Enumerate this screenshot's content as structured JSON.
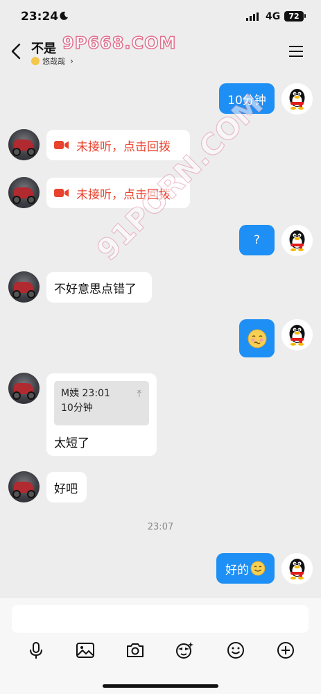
{
  "status_bar": {
    "time": "23:24",
    "network": "4G",
    "battery": "72"
  },
  "header": {
    "title": "不是",
    "status": "悠哉哉",
    "watermark_top": "9P668.COM"
  },
  "watermark_diagonal": "91PORN.COM",
  "messages": [
    {
      "side": "out",
      "text": "10分钟"
    },
    {
      "side": "in",
      "type": "missed_call",
      "text": "未接听，点击回拨"
    },
    {
      "side": "in",
      "type": "missed_call",
      "text": "未接听，点击回拨"
    },
    {
      "side": "out",
      "text": "?"
    },
    {
      "side": "in",
      "text": "不好意思点错了"
    },
    {
      "side": "out",
      "type": "emoji",
      "text": ""
    },
    {
      "side": "in",
      "type": "reply",
      "quote_author_time": "M姨 23:01",
      "quote_text": "10分钟",
      "text": "太短了"
    },
    {
      "side": "in",
      "text": "好吧"
    },
    {
      "side": "out",
      "text": "好的"
    }
  ],
  "time_divider": "23:07",
  "toolbar_icons": [
    "microphone-icon",
    "image-icon",
    "camera-icon",
    "sticker-icon",
    "emoji-icon",
    "plus-icon"
  ],
  "colors": {
    "accent": "#1e8ff5",
    "missed_call": "#e8432e",
    "background": "#ededed"
  }
}
